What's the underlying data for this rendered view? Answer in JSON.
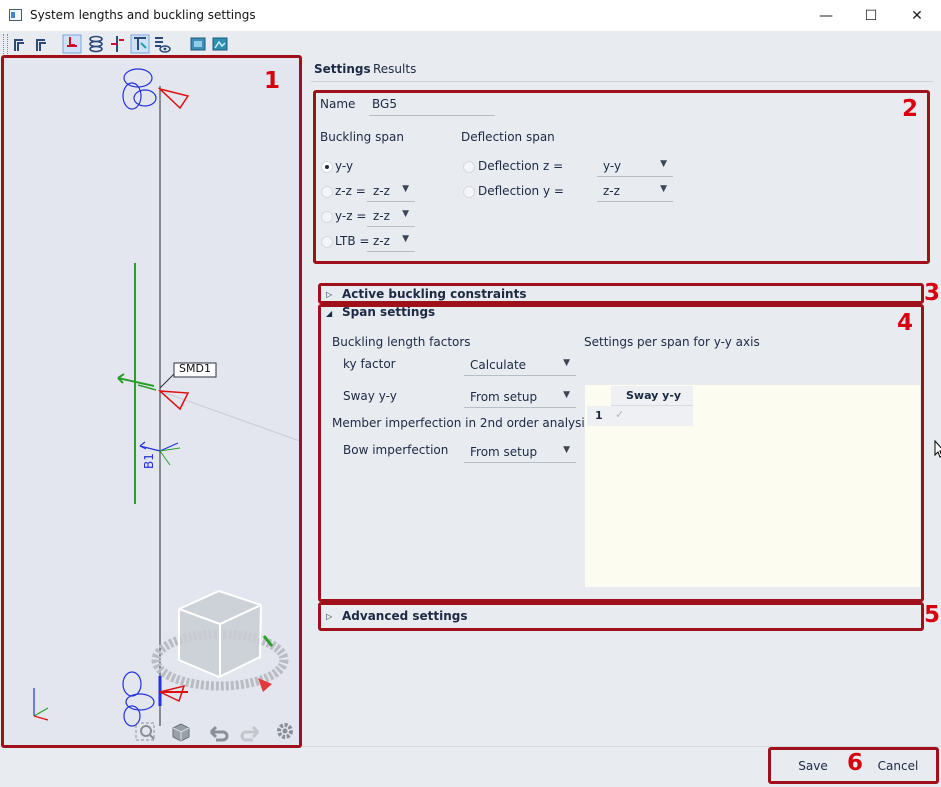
{
  "window": {
    "title": "System lengths and buckling settings",
    "minimize_glyph": "—",
    "maximize_glyph": "☐",
    "close_glyph": "✕"
  },
  "toolbar": {
    "icons": [
      "frame-view-icon",
      "frame-view-2-icon",
      "member-icon",
      "layers-icon",
      "support-icon",
      "node-icon",
      "eye-icon",
      "render-icon",
      "model-icon"
    ]
  },
  "viewport": {
    "member_label": "B1",
    "support_label": "SMD1",
    "nav_icons": [
      "zoom-all-icon",
      "view-cube-icon",
      "undo-view-icon",
      "redo-view-icon",
      "settings-gear-icon"
    ]
  },
  "tabs": [
    {
      "label": "Settings",
      "active": true
    },
    {
      "label": "Results",
      "active": false
    }
  ],
  "form": {
    "name_label": "Name",
    "name_value": "BG5",
    "buckling_span_label": "Buckling span",
    "deflection_span_label": "Deflection span",
    "buckling_options": [
      {
        "label": "y-y",
        "selected": true,
        "combo": ""
      },
      {
        "label": "z-z =",
        "selected": false,
        "combo": "z-z"
      },
      {
        "label": "y-z =",
        "selected": false,
        "combo": "z-z"
      },
      {
        "label": "LTB =",
        "selected": false,
        "combo": "z-z"
      }
    ],
    "deflection_options": [
      {
        "label": "Deflection z =",
        "selected": false,
        "combo": "y-y"
      },
      {
        "label": "Deflection y =",
        "selected": false,
        "combo": "z-z"
      }
    ]
  },
  "sections": {
    "active_constraints": "Active buckling constraints",
    "span_settings": "Span settings",
    "advanced_settings": "Advanced settings"
  },
  "span": {
    "buckling_length_factors": "Buckling length factors",
    "ky_factor_label": "ky factor",
    "ky_factor_value": "Calculate",
    "sway_label": "Sway y-y",
    "sway_value": "From setup",
    "member_imperfection": "Member imperfection in 2nd order analysis",
    "bow_label": "Bow imperfection",
    "bow_value": "From setup",
    "per_span_title": "Settings per span for y-y axis",
    "table_header": "Sway y-y",
    "table_row_index": "1",
    "table_row_check": "✓"
  },
  "buttons": {
    "save": "Save",
    "cancel": "Cancel"
  },
  "annotations": [
    "1",
    "2",
    "3",
    "4",
    "5",
    "6"
  ],
  "colors": {
    "annotation_red": "#d7000f",
    "annotation_box": "#a0101a",
    "axis_green": "#2aa02a",
    "axis_blue": "#2233dd",
    "support_red": "#e01010"
  }
}
